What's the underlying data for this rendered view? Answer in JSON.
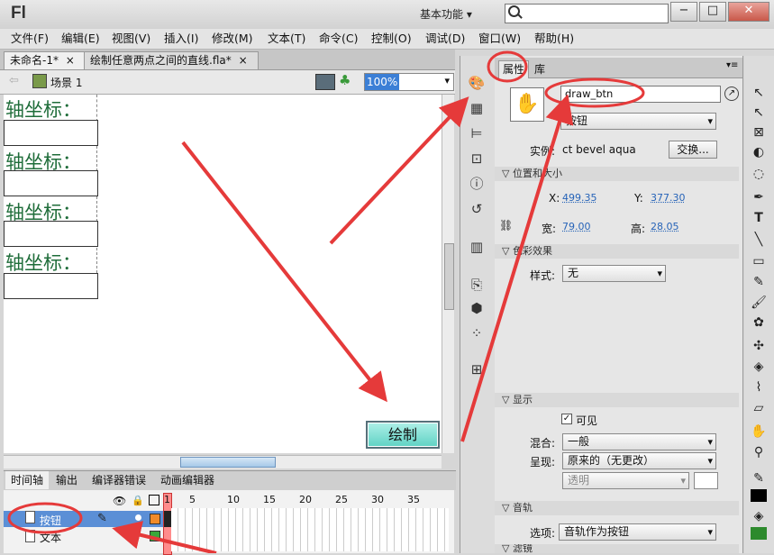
{
  "app": {
    "logo": "Fl",
    "workspace": "基本功能 ▾"
  },
  "window": {
    "minimize": "−",
    "maximize": "□",
    "close": "✕"
  },
  "menu": [
    "文件(F)",
    "编辑(E)",
    "视图(V)",
    "插入(I)",
    "修改(M)",
    "文本(T)",
    "命令(C)",
    "控制(O)",
    "调试(D)",
    "窗口(W)",
    "帮助(H)"
  ],
  "tabs": [
    {
      "label": "未命名-1*",
      "close": "×"
    },
    {
      "label": "绘制任意两点之间的直线.fla*",
      "close": "×"
    }
  ],
  "scene": {
    "label": "场景 1",
    "zoom": "100%"
  },
  "stage": {
    "labels": [
      "轴坐标：",
      "轴坐标：",
      "轴坐标：",
      "轴坐标："
    ],
    "button_label": "绘制"
  },
  "bottom_tabs": [
    "时间轴",
    "输出",
    "编译器错误",
    "动画编辑器"
  ],
  "timeline": {
    "frame_numbers": [
      "1",
      "5",
      "10",
      "15",
      "20",
      "25",
      "30",
      "35"
    ],
    "layers": [
      {
        "name": "按钮",
        "selected": true
      },
      {
        "name": "文本",
        "selected": false
      }
    ]
  },
  "properties": {
    "tab_props": "属性",
    "tab_library": "库",
    "instance_name": "draw_btn",
    "instance_type": "按钮",
    "instance_of_label": "实例:",
    "instance_of_value": "ct bevel aqua",
    "swap_button": "交换...",
    "pos_section": "位置和大小",
    "x_label": "X:",
    "x_value": "499.35",
    "y_label": "Y:",
    "y_value": "377.30",
    "w_label": "宽:",
    "w_value": "79.00",
    "h_label": "高:",
    "h_value": "28.05",
    "color_section": "色彩效果",
    "style_label": "样式:",
    "style_value": "无",
    "display_section": "显示",
    "visible_label": "可见",
    "blend_label": "混合:",
    "blend_value": "一般",
    "render_label": "呈现:",
    "render_value": "原来的（无更改）",
    "transparent_value": "透明",
    "track_section": "音轨",
    "options_label": "选项:",
    "options_value": "音轨作为按钮",
    "filter_section": "滤镜"
  },
  "colors": {
    "accent_red": "#e53a3a",
    "label_green": "#1f6d3a",
    "button_teal": "#5fd2c4"
  }
}
